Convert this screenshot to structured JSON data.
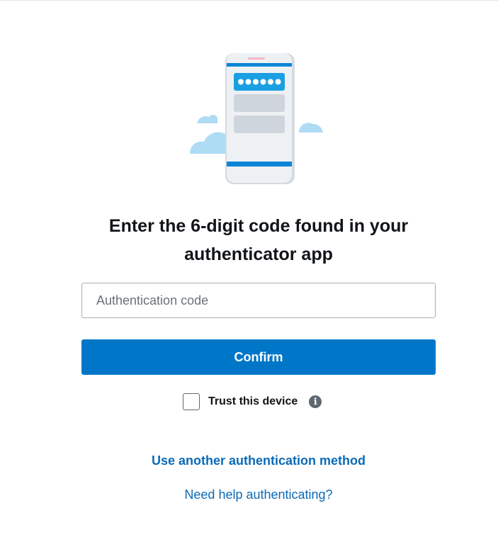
{
  "heading": "Enter the 6-digit code found in your authenticator app",
  "code_input": {
    "placeholder": "Authentication code",
    "value": ""
  },
  "confirm_label": "Confirm",
  "trust_device": {
    "label": "Trust this device",
    "checked": false,
    "info_icon": "info-icon"
  },
  "links": {
    "another_method": "Use another authentication method",
    "help": "Need help authenticating?"
  },
  "illustration": {
    "icon": "phone-with-code-icon",
    "code_dots": 6
  },
  "colors": {
    "accent": "#0076c8",
    "link": "#0b6ab7",
    "cloud": "#aedcf4"
  }
}
